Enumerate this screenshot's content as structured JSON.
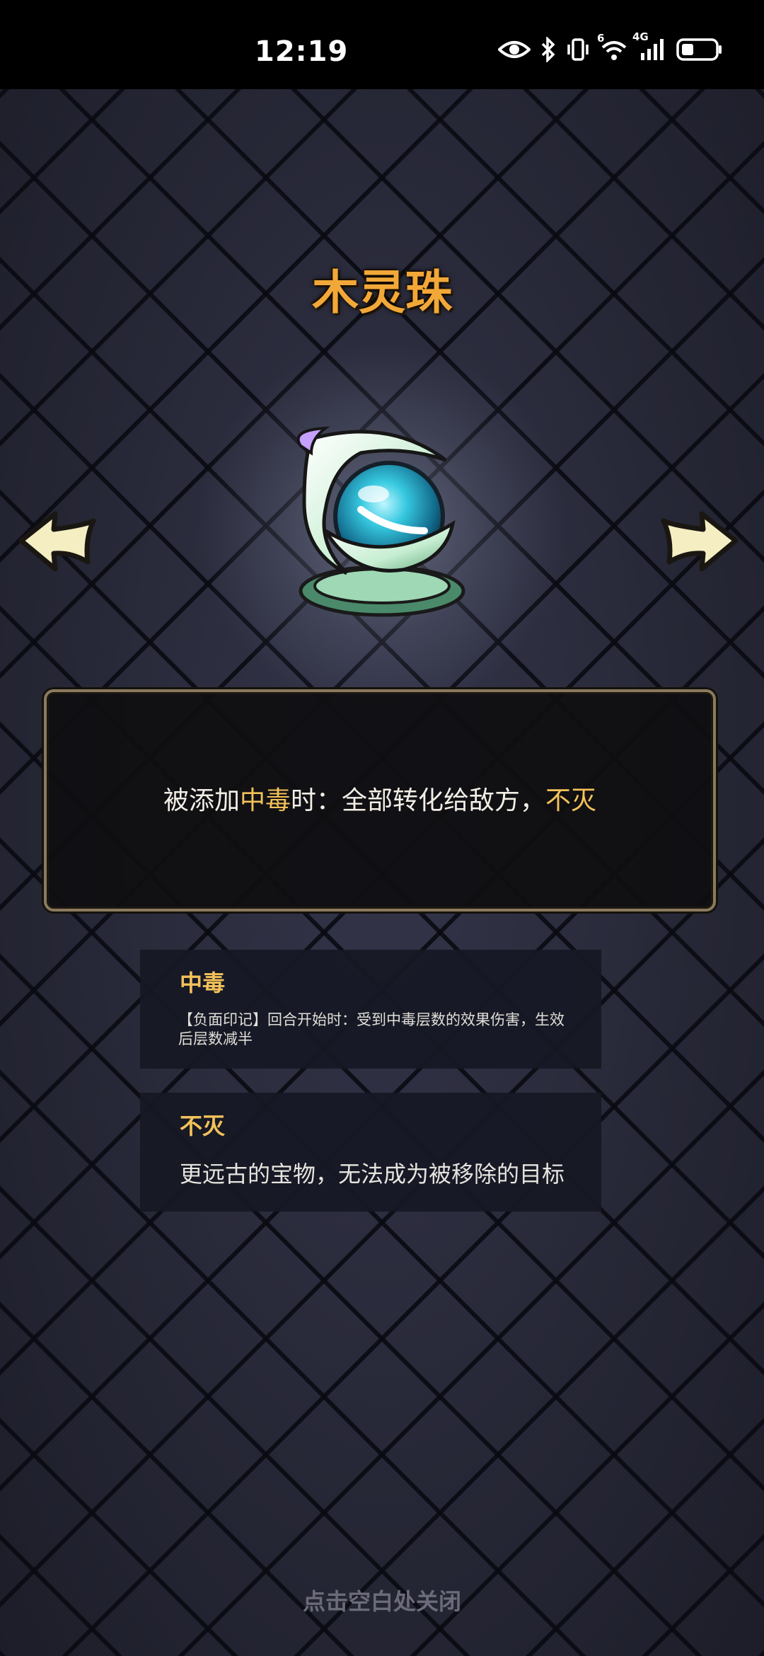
{
  "status_bar": {
    "time": "12:19",
    "icons": [
      "eye-icon",
      "bluetooth-icon",
      "vibrate-icon",
      "wifi-icon",
      "signal-4g-icon",
      "battery-icon"
    ],
    "wifi_badge": "6",
    "signal_badge": "4G"
  },
  "item": {
    "name": "木灵珠",
    "icon": "spirit-orb-icon"
  },
  "description": {
    "part1": "被添加",
    "keyword1": "中毒",
    "part2": "时：全部转化给敌方，",
    "keyword2": "不灭"
  },
  "keywords": [
    {
      "title": "中毒",
      "description": "【负面印记】回合开始时：受到中毒层数的效果伤害，生效后层数减半"
    },
    {
      "title": "不灭",
      "description": "更远古的宝物，无法成为被移除的目标"
    }
  ],
  "close_hint": "点击空白处关闭",
  "colors": {
    "title_orange": "#f2a838",
    "highlight_gold": "#f3c25a",
    "panel_border": "#8b7a5d"
  }
}
